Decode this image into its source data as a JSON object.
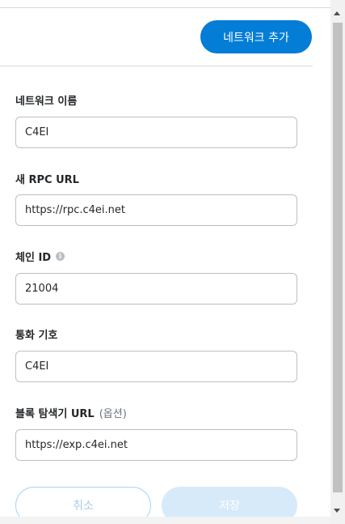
{
  "header": {
    "add_network_label": "네트워크 추가"
  },
  "form": {
    "network_name": {
      "label": "네트워크 이름",
      "value": "C4EI"
    },
    "rpc_url": {
      "label": "새 RPC URL",
      "value": "https://rpc.c4ei.net"
    },
    "chain_id": {
      "label": "체인 ID",
      "value": "21004",
      "info_icon": "info-icon"
    },
    "currency_symbol": {
      "label": "통화 기호",
      "value": "C4EI"
    },
    "block_explorer": {
      "label": "블록 탐색기 URL",
      "optional": "(옵션)",
      "value": "https://exp.c4ei.net"
    }
  },
  "footer": {
    "cancel_label": "취소",
    "save_label": "저장"
  },
  "colors": {
    "primary": "#037dd6",
    "disabled_primary": "#d7eaf9",
    "border": "#bbc0c5"
  }
}
